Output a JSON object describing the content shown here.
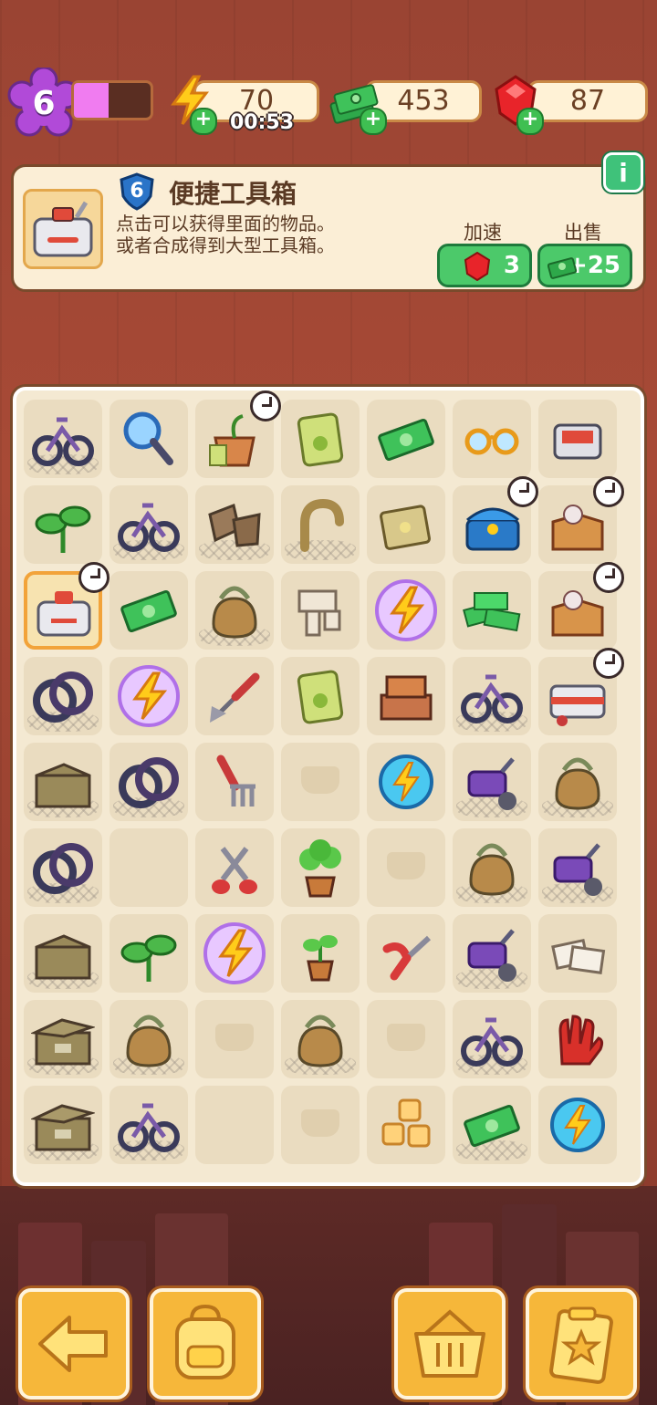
{
  "hud": {
    "level": "6",
    "xp_progress_pct": 45,
    "energy": {
      "value": "70",
      "timer": "00:53",
      "icon": "lightning-icon"
    },
    "cash": {
      "value": "453",
      "icon": "cash-stack-icon"
    },
    "gems": {
      "value": "87",
      "icon": "red-gem-icon"
    },
    "colors": {
      "accent_purple": "#b14ad8",
      "xp_fill": "#f07cf0",
      "plus_green": "#3fbf52"
    }
  },
  "info_panel": {
    "item_level": "6",
    "title": "便捷工具箱",
    "description_line1": "点击可以获得里面的物品。",
    "description_line2": "或者合成得到大型工具箱。",
    "speedup_label": "加速",
    "speedup_cost": "3",
    "sell_label": "出售",
    "sell_value": "+25",
    "info_icon_text": "i"
  },
  "board": {
    "rows": 9,
    "cols": 7,
    "cells": [
      [
        "bicycle",
        "magnifier",
        "seedling-pot",
        "seed-bag",
        "cash",
        "glasses",
        "red-box"
      ],
      [
        "sprout",
        "bicycle",
        "cardboard-scraps",
        "horseshoe",
        "sandpaper",
        "treasure-chest",
        "open-box"
      ],
      [
        "toolbox",
        "cash",
        "net-bag",
        "wood-scraps",
        "energy-orb",
        "cash-pile",
        "open-box"
      ],
      [
        "wheels",
        "energy-orb",
        "trowel",
        "seed-bag",
        "crate-stack",
        "bicycle",
        "toolbox-large"
      ],
      [
        "cardboard-box",
        "wheels",
        "garden-fork",
        "empty",
        "energy-coin",
        "scooter",
        "net-bag"
      ],
      [
        "wheels",
        "empty-plain",
        "shears",
        "potted-plant",
        "empty",
        "net-bag",
        "scooter"
      ],
      [
        "cardboard-box",
        "sprout",
        "energy-orb",
        "small-plant",
        "pruners",
        "scooter",
        "paper-notes"
      ],
      [
        "storage-box",
        "net-bag",
        "empty",
        "net-bag",
        "empty",
        "bicycle",
        "glove"
      ],
      [
        "storage-box",
        "bicycle",
        "empty-plain",
        "empty",
        "sugar-cubes",
        "cash",
        "energy-coin"
      ]
    ]
  },
  "bottom_bar": {
    "buttons": [
      "back-arrow-icon",
      "backpack-icon",
      "shop-basket-icon",
      "task-clipboard-icon"
    ]
  }
}
